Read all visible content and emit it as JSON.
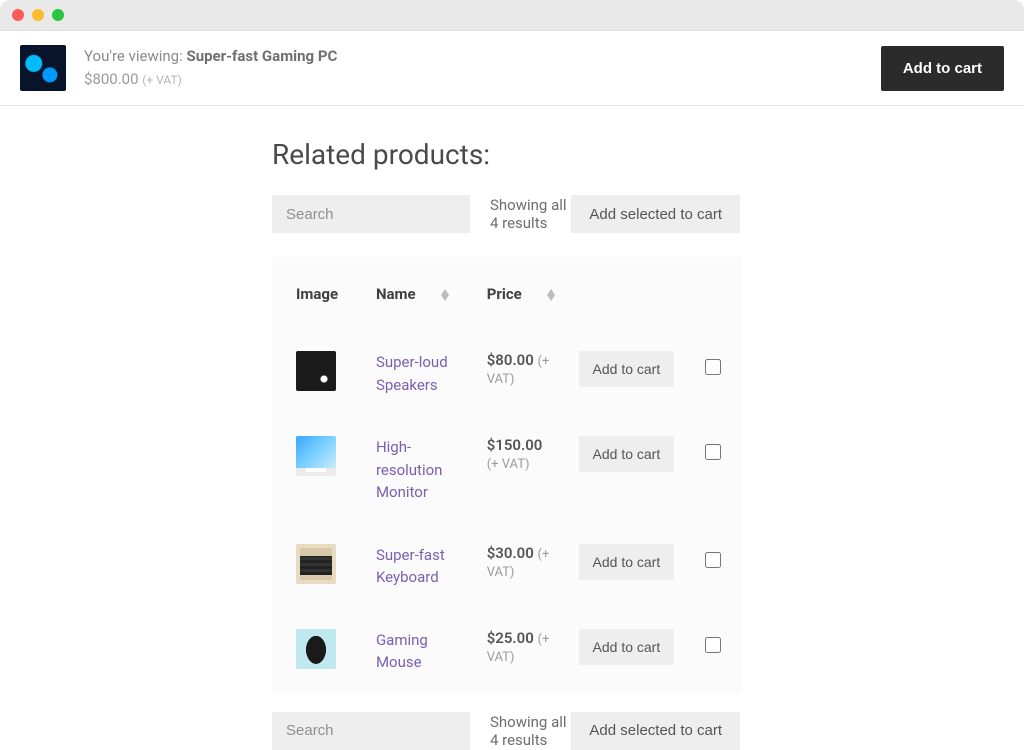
{
  "bar": {
    "viewing_prefix": "You're viewing: ",
    "product_name": "Super-fast Gaming PC",
    "currency": "$",
    "price": "800.00",
    "vat_note": "(+ VAT)",
    "add_to_cart": "Add to cart"
  },
  "section_title": "Related products:",
  "controls": {
    "search_placeholder": "Search",
    "results_label": "Showing all 4 results",
    "add_selected": "Add selected to cart"
  },
  "columns": {
    "image": "Image",
    "name": "Name",
    "price": "Price"
  },
  "row_button": "Add to cart",
  "products": [
    {
      "name": "Super-loud Speakers",
      "price": "80.00",
      "vat_inline": true
    },
    {
      "name": "High-resolution Monitor",
      "price": "150.00",
      "vat_inline": false
    },
    {
      "name": "Super-fast Keyboard",
      "price": "30.00",
      "vat_inline": true
    },
    {
      "name": "Gaming Mouse",
      "price": "25.00",
      "vat_inline": true
    }
  ]
}
